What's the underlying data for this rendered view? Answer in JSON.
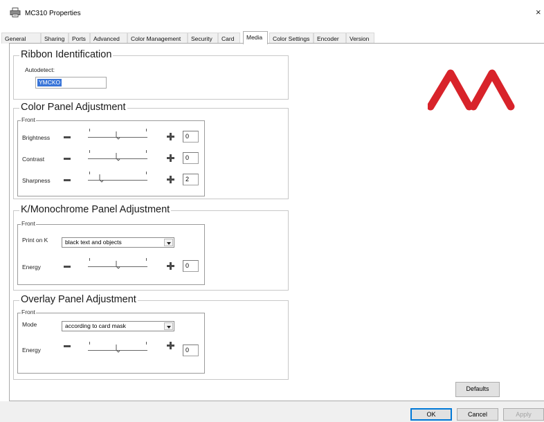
{
  "window": {
    "title": "MC310 Properties",
    "close_glyph": "×",
    "icon": "printer-icon"
  },
  "tabs": [
    {
      "label": "General"
    },
    {
      "label": "Sharing"
    },
    {
      "label": "Ports"
    },
    {
      "label": "Advanced"
    },
    {
      "label": "Color Management"
    },
    {
      "label": "Security"
    },
    {
      "label": "Card"
    },
    {
      "label": "Media",
      "active": true
    },
    {
      "label": "Color Settings"
    },
    {
      "label": "Encoder"
    },
    {
      "label": "Version"
    }
  ],
  "ribbon": {
    "title": "Ribbon Identification",
    "autodetect_label": "Autodetect:",
    "autodetect_value": "YMCKO"
  },
  "color_panel": {
    "title": "Color Panel Adjustment",
    "sub_title": "Front",
    "rows": [
      {
        "label": "Brightness",
        "value": "0"
      },
      {
        "label": "Contrast",
        "value": "0"
      },
      {
        "label": "Sharpness",
        "value": "2"
      }
    ]
  },
  "mono_panel": {
    "title": "K/Monochrome Panel Adjustment",
    "sub_title": "Front",
    "print_on_k_label": "Print on K",
    "print_on_k_value": "black text and objects",
    "energy_label": "Energy",
    "energy_value": "0"
  },
  "overlay_panel": {
    "title": "Overlay Panel Adjustment",
    "sub_title": "Front",
    "mode_label": "Mode",
    "mode_value": "according to card mask",
    "energy_label": "Energy",
    "energy_value": "0"
  },
  "buttons": {
    "defaults": "Defaults",
    "ok": "OK",
    "cancel": "Cancel",
    "apply": "Apply"
  },
  "colors": {
    "logo_red": "#d8232a",
    "selection_blue": "#3874d8",
    "primary_border": "#0078d7"
  }
}
